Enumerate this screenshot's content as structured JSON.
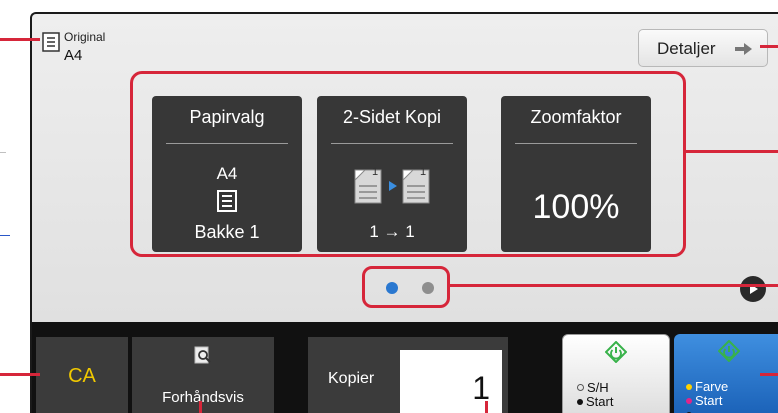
{
  "original": {
    "label": "Original",
    "value": "A4"
  },
  "details_button": {
    "label": "Detaljer"
  },
  "tiles": [
    {
      "title": "Papirvalg",
      "size": "A4",
      "tray": "Bakke 1"
    },
    {
      "title": "2-Sidet Kopi",
      "mode": "1 → 1",
      "page_digit": "1"
    },
    {
      "title": "Zoomfaktor",
      "value": "100%"
    }
  ],
  "pager": {
    "pages": 2,
    "active": 1
  },
  "bottom_bar": {
    "ca": "CA",
    "preview": "Forhåndsvis",
    "copies_label": "Kopier",
    "copies_value": "1",
    "bw_start": {
      "line1": "S/H",
      "line2": "Start"
    },
    "color_start": {
      "line1": "Farve",
      "line2": "Start"
    }
  },
  "colors": {
    "accent_callout": "#d6263a",
    "tile_bg": "#373737",
    "ca_text": "#f0c800",
    "page_dot_active": "#2a78d0",
    "color_start_bg": "#1b62b8",
    "start_icon": "#38b24a"
  }
}
